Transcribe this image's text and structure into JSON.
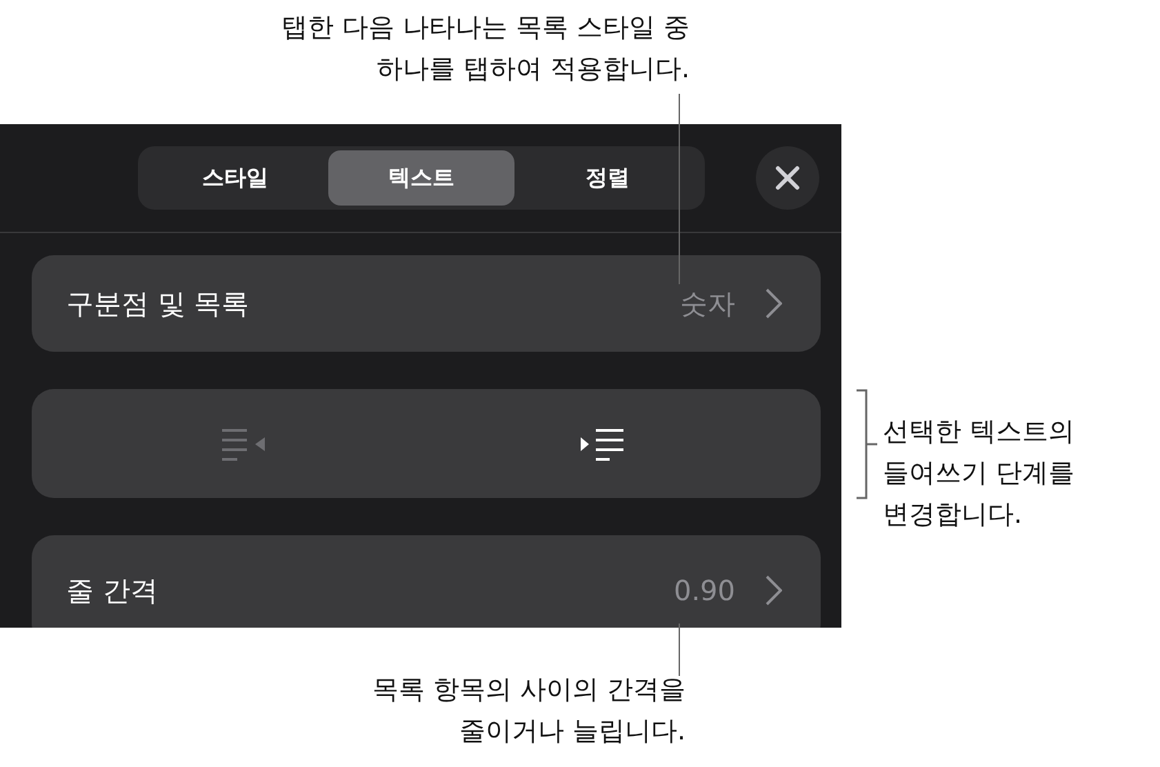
{
  "tabs": [
    {
      "label": "스타일",
      "selected": false
    },
    {
      "label": "텍스트",
      "selected": true
    },
    {
      "label": "정렬",
      "selected": false
    }
  ],
  "rows": [
    {
      "kind": "value",
      "label": "구분점 및 목록",
      "value": "숫자"
    },
    {
      "kind": "indent",
      "buttons": [
        {
          "kind": "decrease",
          "disabled": true
        },
        {
          "kind": "increase",
          "disabled": false
        }
      ]
    },
    {
      "kind": "value",
      "label": "줄 간격",
      "value": "0.90"
    }
  ],
  "callouts": [
    {
      "kind": "top",
      "text": "탭한 다음 나타나는 목록 스타일 중\n하나를 탭하여 적용합니다."
    },
    {
      "kind": "side",
      "text": "선택한 텍스트의\n들여쓰기 단계를\n변경합니다."
    },
    {
      "kind": "bottom",
      "text": "목록 항목의 사이의 간격을\n줄이거나 늘립니다."
    }
  ]
}
